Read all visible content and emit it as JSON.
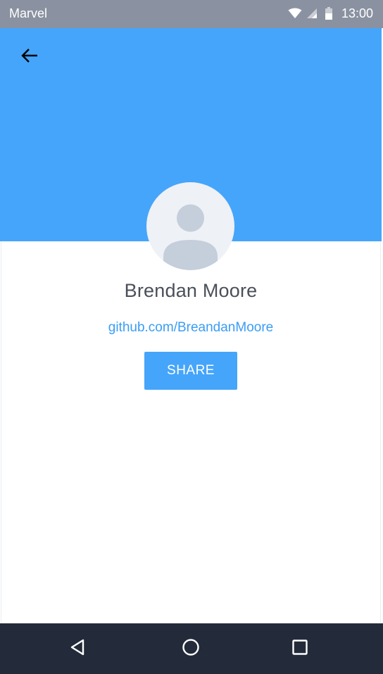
{
  "status_bar": {
    "app_name": "Marvel",
    "time": "13:00",
    "icons": [
      "wifi-icon",
      "cell-signal-icon",
      "battery-icon"
    ]
  },
  "toolbar": {
    "back_icon": "arrow-left-icon"
  },
  "colors": {
    "status_bar": "#8a92a1",
    "header": "#45a5fa",
    "accent": "#45a5fa",
    "link": "#3a9df5",
    "name_text": "#4a4f5a",
    "avatar_bg": "#eef1f6",
    "avatar_figure": "#c5cedb",
    "nav_bar": "#232b3a"
  },
  "profile": {
    "avatar_icon": "user-placeholder-icon",
    "name": "Brendan Moore",
    "link": "github.com/BreandanMoore",
    "share_label": "SHARE"
  },
  "nav_bar": {
    "items": [
      "back-triangle-icon",
      "home-circle-icon",
      "recents-square-icon"
    ]
  }
}
